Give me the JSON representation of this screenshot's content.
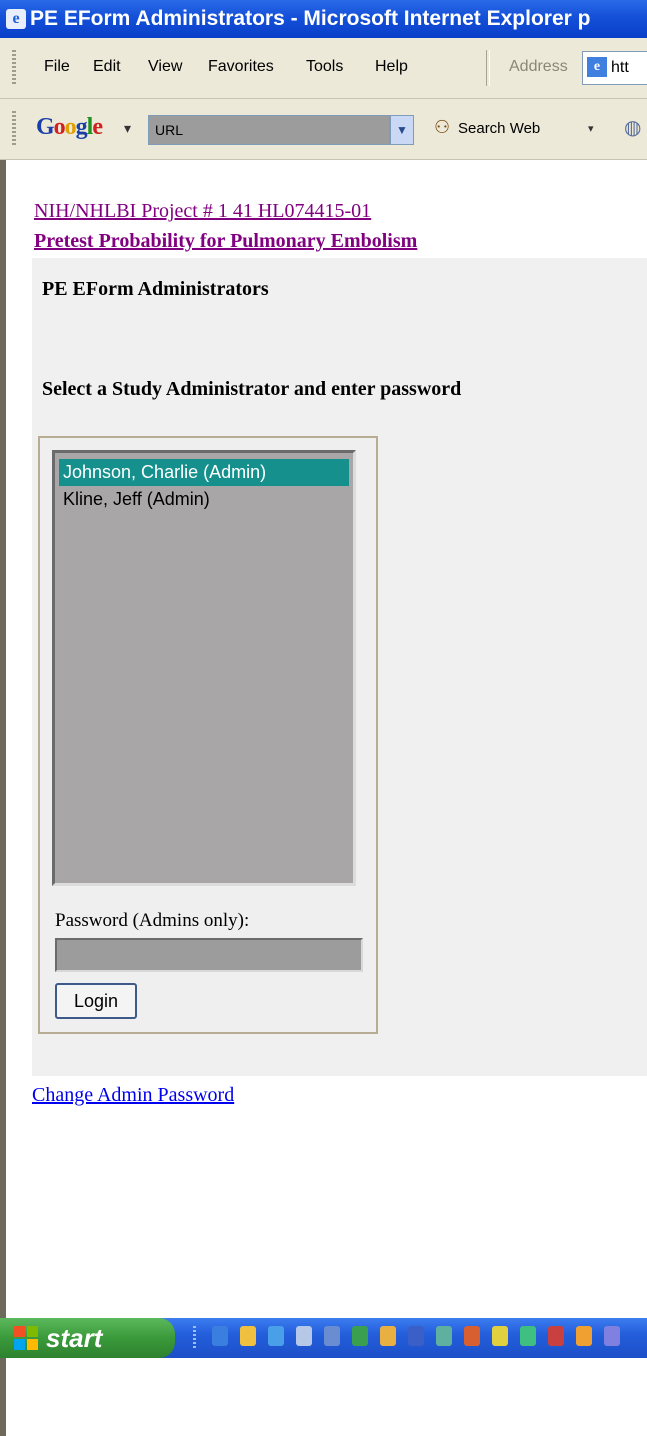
{
  "window": {
    "title": "PE EForm Administrators - Microsoft Internet Explorer p",
    "icon": "ie-page-icon"
  },
  "menubar": {
    "items": [
      "File",
      "Edit",
      "View",
      "Favorites",
      "Tools",
      "Help"
    ],
    "address_label": "Address",
    "address_value": "htt"
  },
  "google_toolbar": {
    "logo": "Google",
    "logo_arrow": "▾",
    "search_value": "URL",
    "search_web_label": "Search Web",
    "search_web_arrow": "▾"
  },
  "page": {
    "project_link": "NIH/NHLBI Project # 1 41 HL074415-01",
    "pe_link": "Pretest Probability for Pulmonary Embolism",
    "panel_title": "PE EForm Administrators",
    "instruction": "Select a Study Administrator and enter password",
    "admins": [
      {
        "label": "Johnson, Charlie (Admin)",
        "selected": true
      },
      {
        "label": "Kline, Jeff (Admin)",
        "selected": false
      }
    ],
    "password_label": "Password (Admins only):",
    "password_value": "",
    "login_label": "Login",
    "change_password_link": "Change Admin Password"
  },
  "taskbar": {
    "start_label": "start",
    "quick_launch_icons": [
      "ie-icon",
      "folder-icon",
      "messenger-icon",
      "media-icon",
      "network-icon",
      "excel-icon",
      "outlook-icon",
      "word-icon",
      "app-icon",
      "app-icon",
      "app-icon",
      "app-icon",
      "app-icon"
    ]
  },
  "colors": {
    "titlebar": "#1450d8",
    "selection": "#16908c",
    "visited_link": "#800080",
    "link": "#0000ee"
  }
}
